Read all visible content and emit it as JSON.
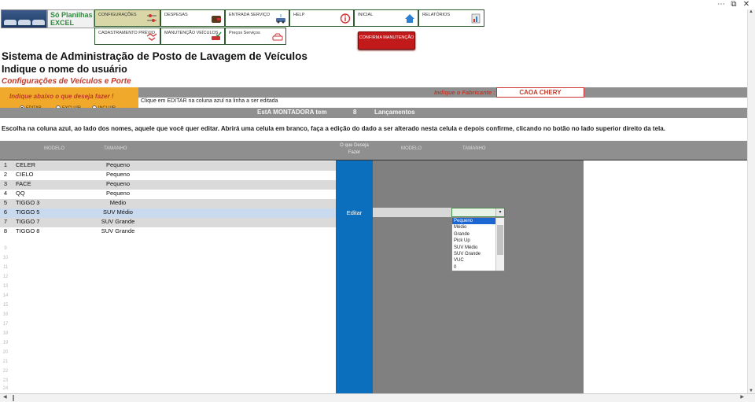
{
  "window": {
    "more_icon": "ellipsis-icon",
    "restore_glyph": "⧉",
    "close_glyph": "✕"
  },
  "logo": {
    "line1": "Só Planilhas",
    "line2": "EXCEL"
  },
  "menu": [
    {
      "label": "CONFIGURAÇÕES",
      "icon": "settings-sliders-icon",
      "active": true
    },
    {
      "label": "DESPESAS",
      "icon": "wallet-icon",
      "active": false
    },
    {
      "label": "ENTRADA SERVIÇO",
      "icon": "car-wash-icon",
      "active": false
    },
    {
      "label": "HELP",
      "icon": "info-icon",
      "active": false
    },
    {
      "label": "INICIAL",
      "icon": "home-icon",
      "active": false
    },
    {
      "label": "RELATÓRIOS",
      "icon": "report-icon",
      "active": false
    },
    {
      "label": "CADASTRAMENTO PRÉVIO",
      "icon": "handshake-icon",
      "active": false
    },
    {
      "label": "MANUTENÇÃO VEÍCULOS",
      "icon": "car-check-icon",
      "active": false
    },
    {
      "label": "Preços Serviços",
      "icon": "car-price-icon",
      "active": false
    }
  ],
  "confirm_button": "CONFIRMA MANUTENÇÃO",
  "header": {
    "title": "Sistema de Administração de Posto de Lavagem de Veículos",
    "user_prompt": "Indique o nome do usuário",
    "section": "Configurações de Veículos e Porte"
  },
  "manufacturer": {
    "label": "Indique o Fabricante :",
    "value": "CAOA CHERY"
  },
  "action_box": {
    "title": "Indique abaixo o que deseja fazer !",
    "options": [
      {
        "label": "EDITAR",
        "selected": true
      },
      {
        "label": "EXCLUIR",
        "selected": false
      },
      {
        "label": "INCLUIR",
        "selected": false
      }
    ]
  },
  "instruction_short": "Clique em EDITAR na coluna azul na linha a ser editada",
  "summary": {
    "montadora": "EstA MONTADORA tem",
    "count": "8",
    "suffix": "Lançamentos"
  },
  "instruction_long": "Escolha na coluna azul, ao lado dos nomes, aquele que você quer editar. Abrirá uma celula em branco, faça a edição do dado a ser alterado nesta celula e depois confirme, clicando no botão no lado superior direito da tela.",
  "table": {
    "headers": {
      "modelo": "MODELO",
      "tamanho": "TAMANHO",
      "blue": "O que Deseja Fazer",
      "modelo2": "MODELO",
      "tamanho2": "TAMANHO"
    },
    "rows": [
      {
        "n": "1",
        "model": "CELER",
        "size": "Pequeno"
      },
      {
        "n": "2",
        "model": "CIELO",
        "size": "Pequeno"
      },
      {
        "n": "3",
        "model": "FACE",
        "size": "Pequeno"
      },
      {
        "n": "4",
        "model": "QQ",
        "size": "Pequeno"
      },
      {
        "n": "5",
        "model": "TIGGO 3",
        "size": "Medio"
      },
      {
        "n": "6",
        "model": "TIGGO 5",
        "size": "SUV Médio"
      },
      {
        "n": "7",
        "model": "TIGGO 7",
        "size": "SUV Grande"
      },
      {
        "n": "8",
        "model": "TIGGO 8",
        "size": "SUV Grande"
      }
    ],
    "empty_row_numbers": [
      "9",
      "10",
      "11",
      "12",
      "13",
      "14",
      "15",
      "16",
      "17",
      "18",
      "19",
      "20",
      "21",
      "22",
      "23",
      "24"
    ],
    "edit_label": "Editar"
  },
  "dropdown": {
    "options": [
      "Pequeno",
      "Médio",
      "Grande",
      "Pick Up",
      "SUV Médio",
      "SUV Grande",
      "VUC",
      "0"
    ],
    "selected_index": 0
  },
  "colors": {
    "brand_green": "#2e8b3c",
    "accent_red": "#c0392b",
    "blue_column": "#0b6fbe",
    "band_grey": "#8f8f8f",
    "orange": "#f0a92b"
  }
}
